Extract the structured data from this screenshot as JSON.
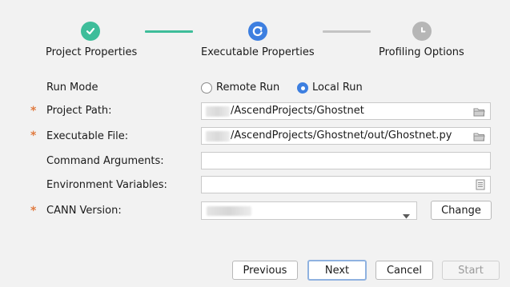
{
  "stepper": {
    "steps": [
      {
        "label": "Project Properties",
        "state": "completed",
        "icon": "check-icon",
        "color": "#3ebd9a"
      },
      {
        "label": "Executable Properties",
        "state": "active",
        "icon": "refresh-icon",
        "color": "#3d7fe0"
      },
      {
        "label": "Profiling Options",
        "state": "pending",
        "icon": "clock-icon",
        "color": "#b6b6b6"
      }
    ],
    "connector_done_color": "#3ebd9a",
    "connector_todo_color": "#c4c4c4"
  },
  "form": {
    "run_mode": {
      "label": "Run Mode",
      "options": [
        {
          "label": "Remote Run",
          "selected": false
        },
        {
          "label": "Local Run",
          "selected": true
        }
      ]
    },
    "project_path": {
      "label": "Project Path:",
      "required": true,
      "value": "/AscendProjects/Ghostnet",
      "icon": "folder-icon"
    },
    "executable_file": {
      "label": "Executable File:",
      "required": true,
      "value": "/AscendProjects/Ghostnet/out/Ghostnet.py",
      "icon": "folder-icon"
    },
    "command_arguments": {
      "label": "Command Arguments:",
      "value": ""
    },
    "environment_variables": {
      "label": "Environment Variables:",
      "value": "",
      "icon": "document-icon"
    },
    "cann_version": {
      "label": "CANN Version:",
      "required": true,
      "value": "",
      "change_label": "Change"
    }
  },
  "required_marker": "*",
  "accent_color": "#3d7fe0",
  "buttons": {
    "previous": "Previous",
    "next": "Next",
    "cancel": "Cancel",
    "start": "Start"
  }
}
